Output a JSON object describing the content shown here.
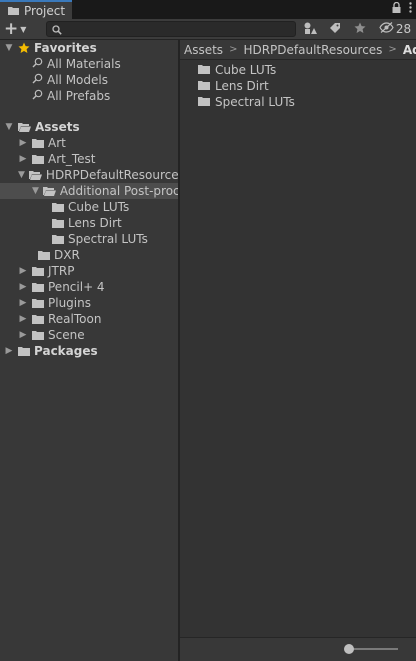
{
  "tab": {
    "title": "Project",
    "icon": "folder-icon"
  },
  "tab_icons": {
    "lock": "lock-icon",
    "menu": "kebab-menu-icon"
  },
  "toolbar": {
    "add_label": "+",
    "search": {
      "value": "",
      "placeholder": ""
    },
    "hidden_count": "28"
  },
  "tree": {
    "favorites": {
      "label": "Favorites",
      "items": [
        "All Materials",
        "All Models",
        "All Prefabs"
      ]
    },
    "assets": {
      "label": "Assets",
      "children": {
        "art": "Art",
        "art_test": "Art_Test",
        "hdrp": "HDRPDefaultResources",
        "additional": "Additional Post-processing Data",
        "cube": "Cube LUTs",
        "lens": "Lens Dirt",
        "spectral": "Spectral LUTs",
        "dxr": "DXR",
        "jtrp": "JTRP",
        "pencil": "Pencil+ 4",
        "plugins": "Plugins",
        "realtoon": "RealToon",
        "scene": "Scene"
      }
    },
    "packages": {
      "label": "Packages"
    }
  },
  "breadcrumb": [
    "Assets",
    "HDRPDefaultResources",
    "Additional Post-processing Data"
  ],
  "contents": [
    "Cube LUTs",
    "Lens Dirt",
    "Spectral LUTs"
  ],
  "colors": {
    "accent": "#3a79bb",
    "star": "#f4bc02",
    "folder": "#c2c2c2",
    "selection": "#4d4d4d"
  }
}
